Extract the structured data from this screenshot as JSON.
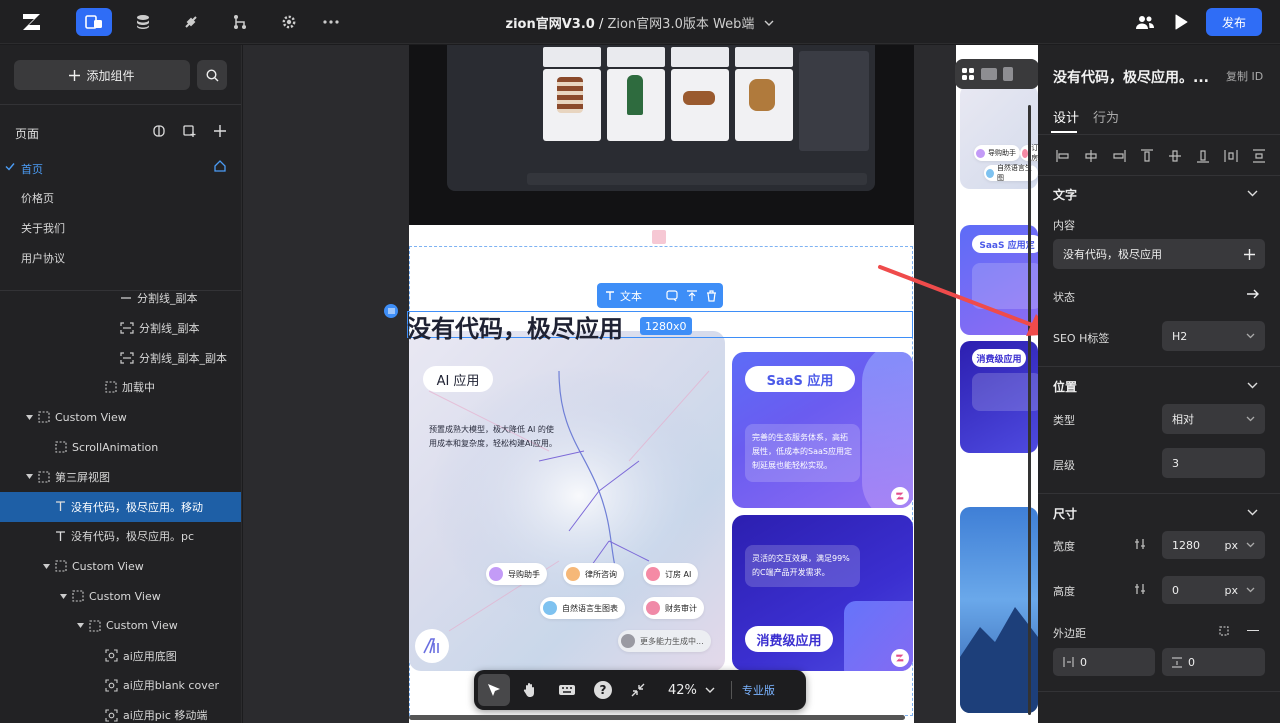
{
  "topbar": {
    "doc_title": "zion官网V3.0",
    "doc_sep": " / ",
    "doc_sub": "Zion官网3.0版本 Web端",
    "publish_label": "发布"
  },
  "left": {
    "add_label": "添加组件",
    "pages_title": "页面",
    "pages": [
      "首页",
      "价格页",
      "关于我们",
      "用户协议"
    ],
    "tree": [
      {
        "label": "分割线_副本",
        "indent": 120,
        "icon": "divider"
      },
      {
        "label": "分割线_副本",
        "indent": 120,
        "icon": "frame"
      },
      {
        "label": "分割线_副本_副本",
        "indent": 120,
        "icon": "frame"
      },
      {
        "label": "加载中",
        "indent": 105,
        "icon": "box"
      },
      {
        "label": "Custom View",
        "indent": 38,
        "icon": "box",
        "caret": true
      },
      {
        "label": "ScrollAnimation",
        "indent": 55,
        "icon": "box"
      },
      {
        "label": "第三屏视图",
        "indent": 38,
        "icon": "box",
        "caret": true
      },
      {
        "label": "没有代码，极尽应用。移动",
        "indent": 55,
        "icon": "text",
        "selected": true
      },
      {
        "label": "没有代码，极尽应用。pc",
        "indent": 55,
        "icon": "text"
      },
      {
        "label": "Custom View",
        "indent": 55,
        "icon": "box",
        "caret": true
      },
      {
        "label": "Custom View",
        "indent": 72,
        "icon": "box",
        "caret": true
      },
      {
        "label": "Custom View",
        "indent": 89,
        "icon": "box",
        "caret": true
      },
      {
        "label": "ai应用底图",
        "indent": 105,
        "icon": "image"
      },
      {
        "label": "ai应用blank cover",
        "indent": 105,
        "icon": "image"
      },
      {
        "label": "ai应用pic 移动端",
        "indent": 105,
        "icon": "image"
      }
    ]
  },
  "canvas": {
    "heading": "没有代码，极尽应用",
    "size_badge": "1280x0",
    "text_toolbar_label": "文本",
    "ai_card": {
      "title": "AI 应用",
      "desc1": "预置成熟大模型，极大降低 AI 的使",
      "desc2": "用成本和复杂度，轻松构建AI应用。",
      "chips": [
        "导购助手",
        "律所咨询",
        "订房 AI",
        "自然语言生图表",
        "财务审计",
        "更多能力生成中..."
      ]
    },
    "saas_card": {
      "title": "SaaS 应用",
      "desc1": "完善的生态服务体系，高拓",
      "desc2": "展性，低成本的SaaS应用定",
      "desc3": "制延展也能轻松实现。"
    },
    "consumer_card": {
      "title": "消费级应用",
      "desc1": "灵活的交互效果，满足99%",
      "desc2": "的C端产品开发需求。"
    },
    "zoom": "42%",
    "plan_label": "专业版",
    "mini": {
      "saas": "SaaS 应用定",
      "cons": "消费级应用",
      "chip1": "导购助手",
      "chip2": "订房",
      "chip3": "自然语言生图"
    }
  },
  "right": {
    "title": "没有代码，极尽应用。...",
    "copy_id": "复制 ID",
    "tabs": [
      "设计",
      "行为"
    ],
    "text_section": "文字",
    "content_label": "内容",
    "content_value": "没有代码，极尽应用",
    "state_label": "状态",
    "seo_label": "SEO H标签",
    "seo_value": "H2",
    "position_section": "位置",
    "type_label": "类型",
    "type_value": "相对",
    "layer_label": "层级",
    "layer_value": "3",
    "size_section": "尺寸",
    "width_label": "宽度",
    "width_value": "1280",
    "width_unit": "px",
    "height_label": "高度",
    "height_value": "0",
    "height_unit": "px",
    "margin_label": "外边距",
    "margin_left": "0",
    "margin_top": "0"
  },
  "colors": {
    "accent": "#2f6df6",
    "selection": "#3e8ef7",
    "annotation_arrow": "#ef4b4b"
  }
}
